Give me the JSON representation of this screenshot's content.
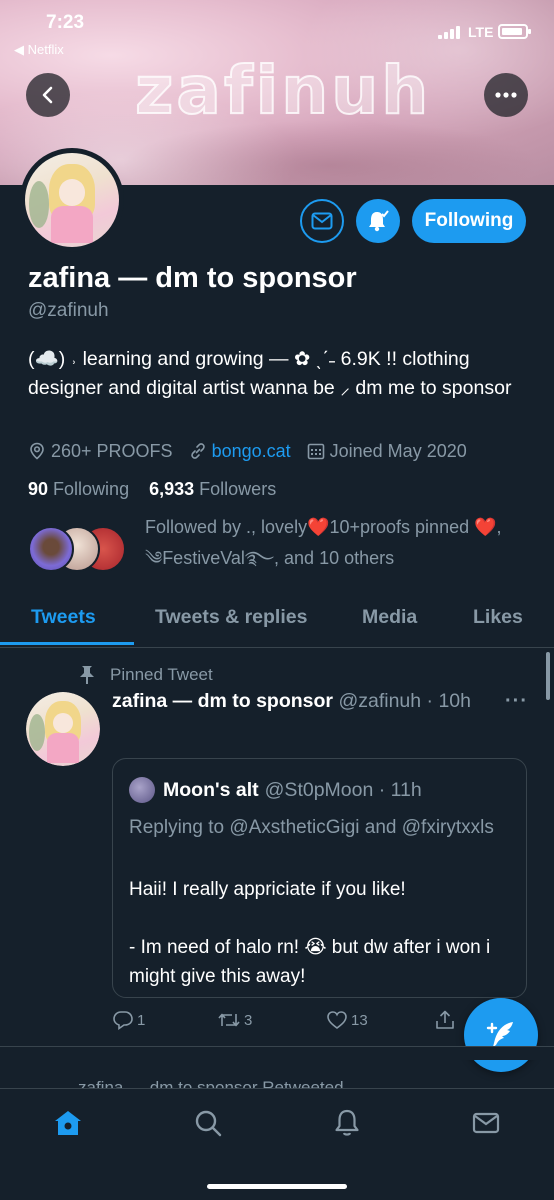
{
  "status_bar": {
    "time": "7:23",
    "back_app": "◀ Netflix",
    "network": "LTE"
  },
  "header": {
    "banner_text": "zafinuh"
  },
  "profile": {
    "name": "zafina — dm to sponsor",
    "handle": "@zafinuh",
    "bio": "(☁️) ˒ learning and growing — ✿ ˎˊ˗ 6.9K !! clothing designer and digital artist wanna be ⸝ dm me to sponsor",
    "proofs": "260+ PROOFS",
    "link": "bongo.cat",
    "joined": "Joined May 2020",
    "following_count": "90",
    "following_label": "Following",
    "followers_count": "6,933",
    "followers_label": "Followers",
    "followed_by": "Followed by ., lovely❤️10+proofs pinned ❤️, ༄FestiveVal࿐, and 10 others",
    "follow_button": "Following"
  },
  "tabs": [
    "Tweets",
    "Tweets & replies",
    "Media",
    "Likes"
  ],
  "tweet": {
    "pinned_label": "Pinned Tweet",
    "author_name": "zafina — dm to sponsor",
    "author_meta": "@zafinuh · 10h",
    "quote": {
      "name": "Moon's alt",
      "meta": "@St0pMoon · 11h",
      "replying": "Replying to @AxstheticGigi and @fxirytxxls",
      "line1": "Haii! I really appriciate if you like!",
      "line2": "- Im need of halo rn! 😭 but dw after i won i might give this away!"
    },
    "replies": "1",
    "retweets": "3",
    "likes": "13"
  },
  "next_tweet_peek": "zafina — dm to sponsor Retweeted",
  "colors": {
    "background": "#15202b",
    "accent": "#1d9bf0",
    "muted": "#8899a6",
    "divider": "#38444d"
  },
  "icons": {
    "back": "chevron-left-icon",
    "more": "more-icon",
    "mail": "mail-icon",
    "bell": "bell-icon",
    "pin": "pin-icon",
    "compose": "compose-icon",
    "home": "home-icon",
    "search": "search-icon",
    "notifications": "notifications-icon",
    "messages": "messages-icon"
  }
}
